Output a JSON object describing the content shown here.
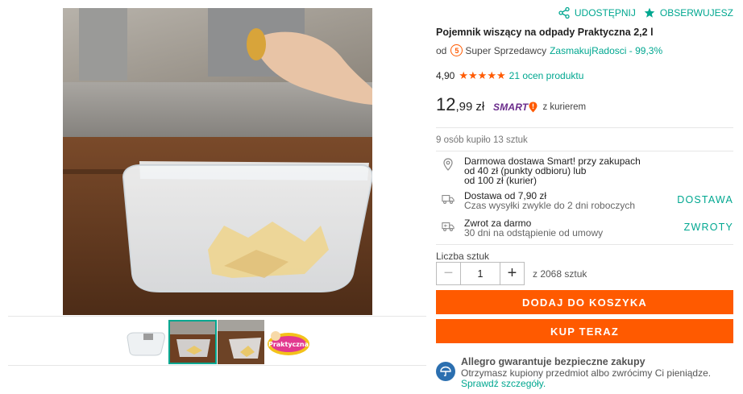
{
  "actions": {
    "share_label": "UDOSTĘPNIJ",
    "watch_label": "OBSERWUJESZ"
  },
  "product": {
    "title": "Pojemnik wiszący na odpady Praktyczna 2,2 l",
    "seller_prefix": "od",
    "seller_badge_digit": "5",
    "seller_type": "Super Sprzedawcy",
    "seller_name": "ZasmakujRadosci - 99,3%",
    "rating_value": "4,90",
    "rating_stars": "★★★★★",
    "rating_count": "21 ocen produktu",
    "price_int": "12",
    "price_dec": ",99",
    "price_currency": "zł",
    "smart_label": "SMART",
    "smart_courier": "z kurierem",
    "bought_text": "9 osób kupiło 13 sztuk"
  },
  "delivery": {
    "free": {
      "line1": "Darmowa dostawa Smart! przy zakupach",
      "line2": "od 40 zł (punkty odbioru) lub",
      "line3": "od 100 zł (kurier)"
    },
    "shipping": {
      "line1": "Dostawa od 7,90 zł",
      "line2": "Czas wysyłki zwykle do 2 dni roboczych",
      "tag": "DOSTAWA"
    },
    "returns": {
      "line1": "Zwrot za darmo",
      "line2": "30 dni na odstąpienie od umowy",
      "tag": "ZWROTY"
    }
  },
  "quantity": {
    "label": "Liczba sztuk",
    "value": "1",
    "minus": "−",
    "plus": "+",
    "available": "z 2068 sztuk"
  },
  "buttons": {
    "add_to_cart": "DODAJ DO KOSZYKA",
    "buy_now": "KUP TERAZ"
  },
  "guarantee": {
    "title": "Allegro gwarantuje bezpieczne zakupy",
    "text": "Otrzymasz kupiony przedmiot albo zwrócimy Ci pieniądze.",
    "link": "Sprawdź szczegóły."
  },
  "colors": {
    "accent": "#00a790",
    "cta": "#ff5a00",
    "stars": "#ff5a00",
    "smart": "#6a2b8b",
    "shield": "#2b6fb0"
  },
  "gallery": {
    "thumb_logo_text": "Praktyczna",
    "thumbnails": [
      "thumb-product-front",
      "thumb-product-hanging",
      "thumb-product-in-use",
      "thumb-brand-logo"
    ]
  }
}
